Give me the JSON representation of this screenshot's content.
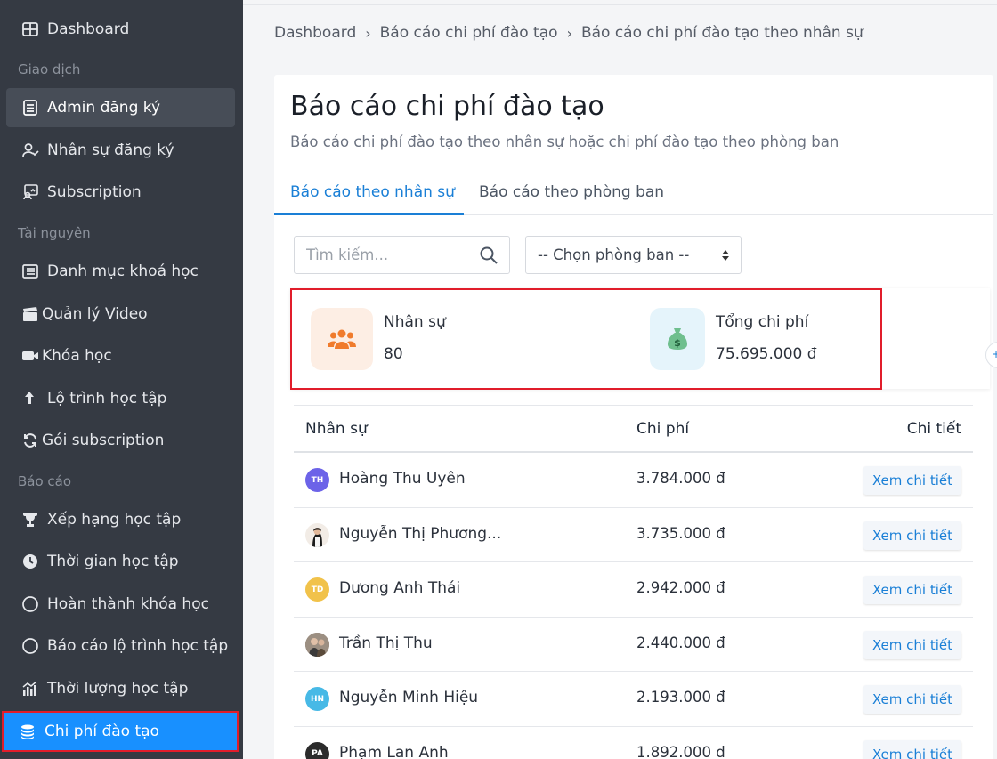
{
  "sidebar": {
    "items": [
      {
        "label": "Dashboard",
        "icon": "dashboard-icon"
      },
      {
        "label": "Admin đăng ký",
        "icon": "list-icon"
      },
      {
        "label": "Nhân sự đăng ký",
        "icon": "user-check-icon"
      },
      {
        "label": "Subscription",
        "icon": "subscription-icon"
      },
      {
        "label": "Danh mục khoá học",
        "icon": "catalog-icon"
      },
      {
        "label": "Quản lý Video",
        "icon": "clapper-icon"
      },
      {
        "label": "Khóa học",
        "icon": "video-camera-icon"
      },
      {
        "label": "Lộ trình học tập",
        "icon": "arrow-up-icon"
      },
      {
        "label": "Gói subscription",
        "icon": "refresh-icon"
      },
      {
        "label": "Xếp hạng học tập",
        "icon": "trophy-icon"
      },
      {
        "label": "Thời gian học tập",
        "icon": "clock-icon"
      },
      {
        "label": "Hoàn thành khóa học",
        "icon": "circle-icon"
      },
      {
        "label": "Báo cáo lộ trình học tập",
        "icon": "circle-icon"
      },
      {
        "label": "Thời lượng học tập",
        "icon": "bar-chart-icon"
      },
      {
        "label": "Chi phí đào tạo",
        "icon": "coins-icon"
      }
    ],
    "sections": [
      "Giao dịch",
      "Tài nguyên",
      "Báo cáo"
    ]
  },
  "breadcrumb": [
    "Dashboard",
    "Báo cáo chi phí đào tạo",
    "Báo cáo chi phí đào tạo theo nhân sự"
  ],
  "page": {
    "title": "Báo cáo chi phí đào tạo",
    "subtitle": "Báo cáo chi phí đào tạo theo nhân sự hoặc chi phí đào tạo theo phòng ban"
  },
  "tabs": [
    "Báo cáo theo nhân sự",
    "Báo cáo theo phòng ban"
  ],
  "filters": {
    "search_placeholder": "Tìm kiếm...",
    "department_select": "-- Chọn phòng ban --"
  },
  "stats": {
    "staff_label": "Nhân sự",
    "staff_value": "80",
    "cost_label": "Tổng chi phí",
    "cost_value": "75.695.000 đ"
  },
  "colors": {
    "sidebar_bg": "#353a43",
    "accent": "#1a7fd6",
    "current_item": "#1890ff",
    "highlight_border": "#e11d2b"
  },
  "table": {
    "headers": [
      "Nhân sự",
      "Chi phí",
      "Chi tiết"
    ],
    "rows": [
      {
        "initials": "TH",
        "name": "Hoàng Thu Uyên",
        "cost": "3.784.000 đ",
        "action": "Xem chi tiết"
      },
      {
        "initials": "",
        "name": "Nguyễn Thị Phương...",
        "cost": "3.735.000 đ",
        "action": "Xem chi tiết"
      },
      {
        "initials": "TD",
        "name": "Dương Anh Thái",
        "cost": "2.942.000 đ",
        "action": "Xem chi tiết"
      },
      {
        "initials": "",
        "name": "Trần Thị Thu",
        "cost": "2.440.000 đ",
        "action": "Xem chi tiết"
      },
      {
        "initials": "HN",
        "name": "Nguyễn Minh Hiệu",
        "cost": "2.193.000 đ",
        "action": "Xem chi tiết"
      },
      {
        "initials": "PA",
        "name": "Phạm Lan Anh",
        "cost": "1.892.000 đ",
        "action": "Xem chi tiết"
      }
    ]
  }
}
